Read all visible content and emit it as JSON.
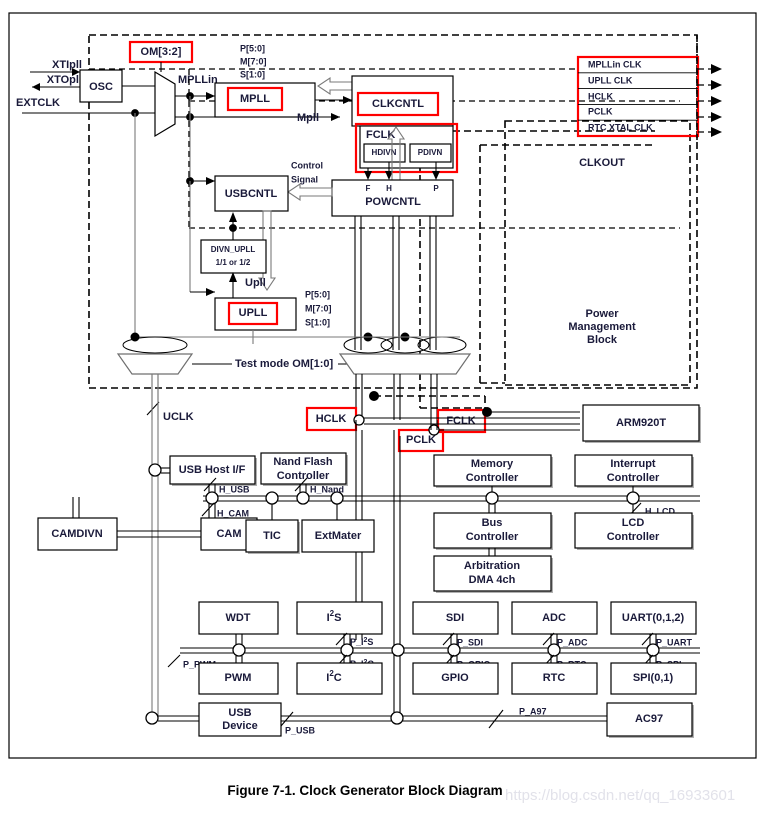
{
  "figure": {
    "caption": "Figure 7-1. Clock Generator Block Diagram",
    "watermark": "https://blog.csdn.net/qq_16933601"
  },
  "inputs": {
    "xtipll": "XTIpll",
    "xtopll": "XTOpll",
    "extclk": "EXTCLK"
  },
  "clock_gen": {
    "osc": "OSC",
    "om_sel": "OM[3:2]",
    "mpllin": "MPLLin",
    "mpll": "MPLL",
    "mpll_out": "Mpll",
    "pms_top": {
      "p": "P[5:0]",
      "m": "M[7:0]",
      "s": "S[1:0]"
    },
    "clkcntl": "CLKCNTL",
    "fclk_group": "FCLK",
    "hdivn": "HDIVN",
    "pdivn": "PDIVN",
    "powcntl": "POWCNTL",
    "powcntl_f": "F",
    "powcntl_h": "H",
    "powcntl_p": "P",
    "control_signal_1": "Control",
    "control_signal_2": "Signal",
    "usbcntl": "USBCNTL",
    "divn_upll_1": "DIVN_UPLL",
    "divn_upll_2": "1/1 or 1/2",
    "upll_label": "Upll",
    "upll": "UPLL",
    "pms_bottom": {
      "p": "P[5:0]",
      "m": "M[7:0]",
      "s": "S[1:0]"
    },
    "test_mode": "Test mode OM[1:0]"
  },
  "power_block": {
    "title_line1": "Power",
    "title_line2": "Management",
    "title_line3": "Block",
    "clkout": "CLKOUT",
    "outputs": [
      "MPLLin CLK",
      "UPLL CLK",
      "HCLK",
      "PCLK",
      "RTC XTAL CLK"
    ]
  },
  "clocks": {
    "uclk": "UCLK",
    "hclk": "HCLK",
    "pclk": "PCLK",
    "fclk": "FCLK"
  },
  "cpu": {
    "arm": "ARM920T"
  },
  "ahb_blocks": [
    {
      "id": "usb-host-if",
      "label": "USB Host I/F"
    },
    {
      "id": "nand-flash-controller",
      "label_1": "Nand Flash",
      "label_2": "Controller"
    },
    {
      "id": "memory-controller",
      "label_1": "Memory",
      "label_2": "Controller"
    },
    {
      "id": "interrupt-controller",
      "label_1": "Interrupt",
      "label_2": "Controller"
    },
    {
      "id": "camdivn",
      "label": "CAMDIVN"
    },
    {
      "id": "cam",
      "label": "CAM"
    },
    {
      "id": "tic",
      "label": "TIC"
    },
    {
      "id": "extmater",
      "label": "ExtMater"
    },
    {
      "id": "bus-controller",
      "label_1": "Bus",
      "label_2": "Controller"
    },
    {
      "id": "lcd-controller",
      "label_1": "LCD",
      "label_2": "Controller"
    },
    {
      "id": "arbitration-dma",
      "label_1": "Arbitration",
      "label_2": "DMA 4ch"
    }
  ],
  "ahb_signals": {
    "h_usb": "H_USB",
    "h_cam": "H_CAM",
    "h_nand": "H_Nand",
    "h_lcd": "H_LCD"
  },
  "apb_blocks_top": [
    {
      "id": "wdt",
      "label": "WDT"
    },
    {
      "id": "i2s",
      "label": "I",
      "sup": "2",
      "label2": "S"
    },
    {
      "id": "sdi",
      "label": "SDI"
    },
    {
      "id": "adc",
      "label": "ADC"
    },
    {
      "id": "uart",
      "label": "UART(0,1,2)"
    }
  ],
  "apb_blocks_bottom": [
    {
      "id": "pwm",
      "label": "PWM"
    },
    {
      "id": "i2c",
      "label": "I",
      "sup": "2",
      "label2": "C"
    },
    {
      "id": "gpio",
      "label": "GPIO"
    },
    {
      "id": "rtc",
      "label": "RTC"
    },
    {
      "id": "spi",
      "label": "SPI(0,1)"
    }
  ],
  "apb_signals": {
    "p_i2s_pre": "P_I",
    "p_i2s_sup": "2",
    "p_i2s_post": "S",
    "p_pwm": "P_PWM",
    "p_i2c_pre": "P_I",
    "p_i2c_sup": "2",
    "p_i2c_post": "C",
    "p_sdi": "P_SDI",
    "p_gpio": "P_GPIO",
    "p_adc": "P_ADC",
    "p_rtc": "P_RTC",
    "p_uart": "P_UART",
    "p_spi": "P_SPI",
    "p_usb": "P_USB",
    "p_a97": "P_A97"
  },
  "bottom_blocks": [
    {
      "id": "usb-device",
      "label_1": "USB",
      "label_2": "Device"
    },
    {
      "id": "ac97",
      "label": "AC97"
    }
  ],
  "colors": {
    "highlight": "#ff0000",
    "text": "#1a1a3a",
    "wire": "#000000"
  }
}
